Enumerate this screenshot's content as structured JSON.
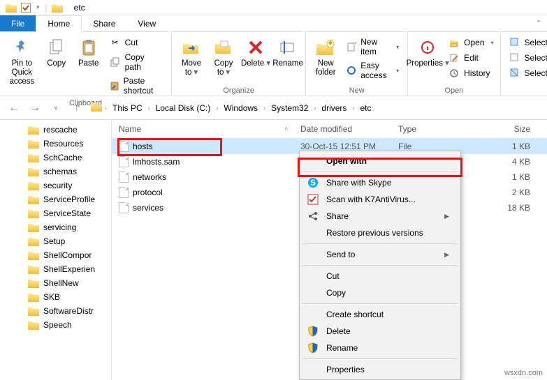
{
  "titlebar": {
    "folder_name": "etc"
  },
  "tabs": {
    "file": "File",
    "home": "Home",
    "share": "Share",
    "view": "View"
  },
  "ribbon": {
    "groups": {
      "clipboard": {
        "label": "Clipboard",
        "pin": "Pin to Quick access",
        "copy": "Copy",
        "paste": "Paste",
        "cut": "Cut",
        "copy_path": "Copy path",
        "paste_shortcut": "Paste shortcut"
      },
      "organize": {
        "label": "Organize",
        "move_to": "Move to",
        "copy_to": "Copy to",
        "delete": "Delete",
        "rename": "Rename"
      },
      "new": {
        "label": "New",
        "new_folder": "New folder",
        "new_item": "New item",
        "easy_access": "Easy access"
      },
      "open": {
        "label": "Open",
        "properties": "Properties",
        "open": "Open",
        "edit": "Edit",
        "history": "History"
      },
      "select": {
        "select_all": "Select"
      }
    }
  },
  "address": {
    "crumbs": [
      "This PC",
      "Local Disk (C:)",
      "Windows",
      "System32",
      "drivers",
      "etc"
    ]
  },
  "tree": {
    "items": [
      "rescache",
      "Resources",
      "SchCache",
      "schemas",
      "security",
      "ServiceProfile",
      "ServiceState",
      "servicing",
      "Setup",
      "ShellCompor",
      "ShellExperien",
      "ShellNew",
      "SKB",
      "SoftwareDistr",
      "Speech"
    ]
  },
  "list": {
    "columns": {
      "name": "Name",
      "date": "Date modified",
      "type": "Type",
      "size": "Size"
    },
    "rows": [
      {
        "name": "hosts",
        "date": "30-Oct-15 12:51 PM",
        "type": "File",
        "size": "1 KB",
        "selected": true
      },
      {
        "name": "lmhosts.sam",
        "date": "",
        "type": "",
        "size": "4 KB",
        "selected": false
      },
      {
        "name": "networks",
        "date": "",
        "type": "",
        "size": "1 KB",
        "selected": false
      },
      {
        "name": "protocol",
        "date": "",
        "type": "",
        "size": "2 KB",
        "selected": false
      },
      {
        "name": "services",
        "date": "",
        "type": "",
        "size": "18 KB",
        "selected": false
      }
    ]
  },
  "context_menu": {
    "items": [
      {
        "label": "Open with",
        "bold": true,
        "icon": "",
        "sep_after": true
      },
      {
        "label": "Share with Skype",
        "icon": "skype"
      },
      {
        "label": "Scan with K7AntiVirus...",
        "icon": "k7"
      },
      {
        "label": "Share",
        "icon": "share",
        "submenu": true
      },
      {
        "label": "Restore previous versions",
        "sep_after": true
      },
      {
        "label": "Send to",
        "submenu": true,
        "sep_after": true
      },
      {
        "label": "Cut"
      },
      {
        "label": "Copy",
        "sep_after": true
      },
      {
        "label": "Create shortcut"
      },
      {
        "label": "Delete",
        "icon": "shield"
      },
      {
        "label": "Rename",
        "icon": "shield",
        "sep_after": true
      },
      {
        "label": "Properties"
      }
    ]
  },
  "watermark": "wsxdn.com"
}
